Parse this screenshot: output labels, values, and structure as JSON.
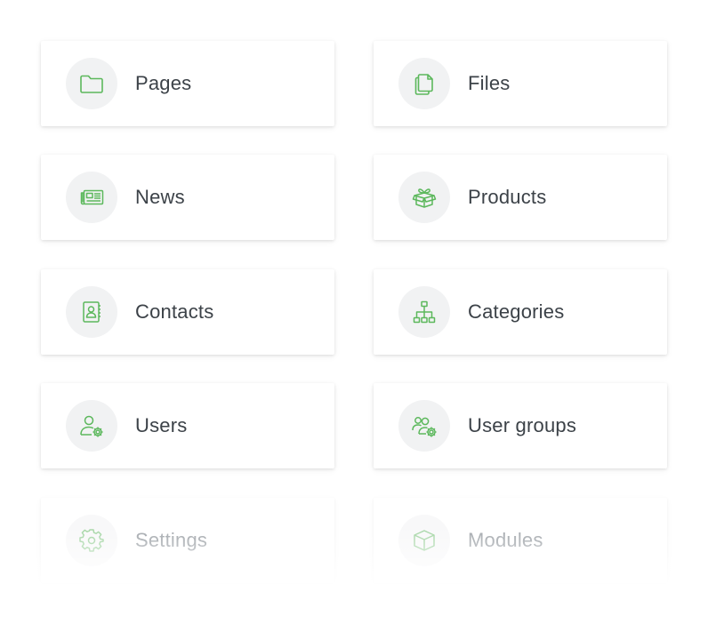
{
  "accent_color": "#5cb85c",
  "tiles": [
    {
      "label": "Pages",
      "icon": "folder-icon"
    },
    {
      "label": "Files",
      "icon": "files-icon"
    },
    {
      "label": "News",
      "icon": "newspaper-icon"
    },
    {
      "label": "Products",
      "icon": "gift-box-icon"
    },
    {
      "label": "Contacts",
      "icon": "address-book-icon"
    },
    {
      "label": "Categories",
      "icon": "sitemap-icon"
    },
    {
      "label": "Users",
      "icon": "user-gear-icon"
    },
    {
      "label": "User groups",
      "icon": "users-gear-icon"
    },
    {
      "label": "Settings",
      "icon": "gear-icon"
    },
    {
      "label": "Modules",
      "icon": "cube-icon"
    }
  ]
}
